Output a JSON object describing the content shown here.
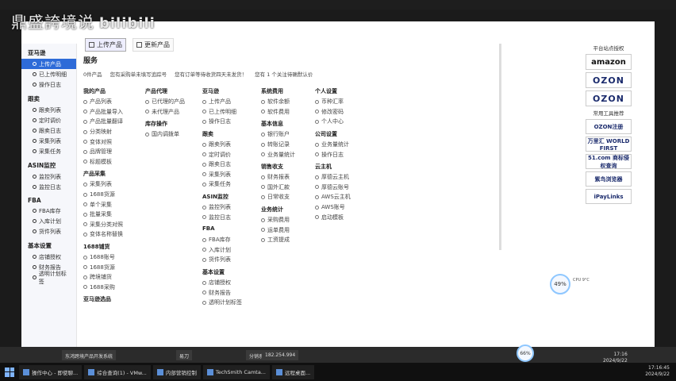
{
  "overlay": {
    "text": "鼎盛誇境说",
    "brand": "bilibili"
  },
  "topbar": {
    "upload": "上传产品",
    "update": "更新产品"
  },
  "sidebar": {
    "groups": [
      {
        "title": "亚马逊",
        "items": [
          "上传产品",
          "已上传明细",
          "操作日志"
        ]
      },
      {
        "title": "跟卖",
        "items": [
          "跟卖列表",
          "定时调价",
          "跟卖日志",
          "采集列表",
          "采集任务"
        ]
      },
      {
        "title": "ASIN监控",
        "items": [
          "监控列表",
          "监控日志"
        ]
      },
      {
        "title": "FBA",
        "items": [
          "FBA库存",
          "入库计划",
          "货件列表"
        ]
      },
      {
        "title": "基本设置",
        "items": [
          "店铺授权",
          "财务报告",
          "透明计划标签"
        ]
      }
    ]
  },
  "main": {
    "title": "服务",
    "tips": [
      "0件产品",
      "您有采购单未填写追踪号",
      "您有订单等待收货四天未发货！",
      "您有 1 个关注待确默认价"
    ],
    "columns": [
      {
        "sections": [
          {
            "head": "我的产品",
            "items": [
              "产品列表",
              "产品批量导入",
              "产品批量翻译",
              "分类映射",
              "变体对照",
              "品牌管理",
              "标题模板"
            ]
          },
          {
            "head": "产品采集",
            "items": [
              "采集列表",
              "1688货源",
              "单个采集",
              "批量采集",
              "采集分类对照",
              "变体名称替换"
            ]
          },
          {
            "head": "1688铺货",
            "items": [
              "1688账号",
              "1688货源",
              "跨境铺货",
              "1688采购"
            ]
          },
          {
            "head": "亚马逊选品",
            "items": []
          }
        ]
      },
      {
        "sections": [
          {
            "head": "产品代理",
            "items": [
              "已代理的产品",
              "未代理产品"
            ]
          },
          {
            "head": "库存操作",
            "items": [
              "国内调拨单"
            ]
          }
        ]
      },
      {
        "sections": [
          {
            "head": "亚马逊",
            "items": [
              "上传产品",
              "已上传明细",
              "操作日志"
            ]
          },
          {
            "head": "跟卖",
            "items": [
              "跟卖列表",
              "定时调价",
              "跟卖日志",
              "采集列表",
              "采集任务"
            ]
          },
          {
            "head": "ASIN监控",
            "items": [
              "监控列表",
              "监控日志"
            ]
          },
          {
            "head": "FBA",
            "items": [
              "FBA库存",
              "入库计划",
              "货件列表"
            ]
          },
          {
            "head": "基本设置",
            "items": [
              "店铺授权",
              "财务报告",
              "透明计划标签"
            ]
          }
        ]
      },
      {
        "sections": [
          {
            "head": "系统费用",
            "items": [
              "软件余额",
              "软件费用"
            ]
          },
          {
            "head": "基本信息",
            "items": [
              "银行账户",
              "转账记录",
              "业务量统计"
            ]
          },
          {
            "head": "销售收支",
            "items": [
              "财务报表",
              "国外汇款",
              "日常收支"
            ]
          },
          {
            "head": "业务统计",
            "items": [
              "采购费用",
              "运单费用",
              "工资提成"
            ]
          }
        ]
      },
      {
        "sections": [
          {
            "head": "个人设置",
            "items": [
              "币种汇率",
              "修改密码",
              "个人中心"
            ]
          },
          {
            "head": "公司设置",
            "items": [
              "业务量统计",
              "操作日志"
            ]
          },
          {
            "head": "云主机",
            "items": [
              "厚德云主机",
              "厚德云账号",
              "AWS云主机",
              "AWS账号",
              "启动模板"
            ]
          }
        ]
      }
    ]
  },
  "right": {
    "platform_label": "平台站点授权",
    "brands": [
      "amazon",
      "OZON",
      "OZON"
    ],
    "tools_label": "常用工具推荐",
    "tools": [
      "OZON注册",
      "万里汇 WORLD FIRST",
      "51.com 商标侵权查询",
      "紫鸟浏览器",
      "iPayLinks"
    ]
  },
  "perf": {
    "cpu": "49%",
    "cpu_note": "CPU 9°C",
    "mem": "66%"
  },
  "subbar": {
    "windows": [
      "东鸿跨境产品开发系统",
      "易刀",
      "分销系统",
      "182.254.994"
    ]
  },
  "taskbar": {
    "items": [
      "操作中心 - 即使聊...",
      "综合查询(1) - VMw...",
      "内部营销控制",
      "TechSmith Camta...",
      "远程桌面..."
    ],
    "time": "17:16:45",
    "date": "2024/9/22",
    "inner_time": "17:16",
    "inner_date": "2024/9/22"
  }
}
